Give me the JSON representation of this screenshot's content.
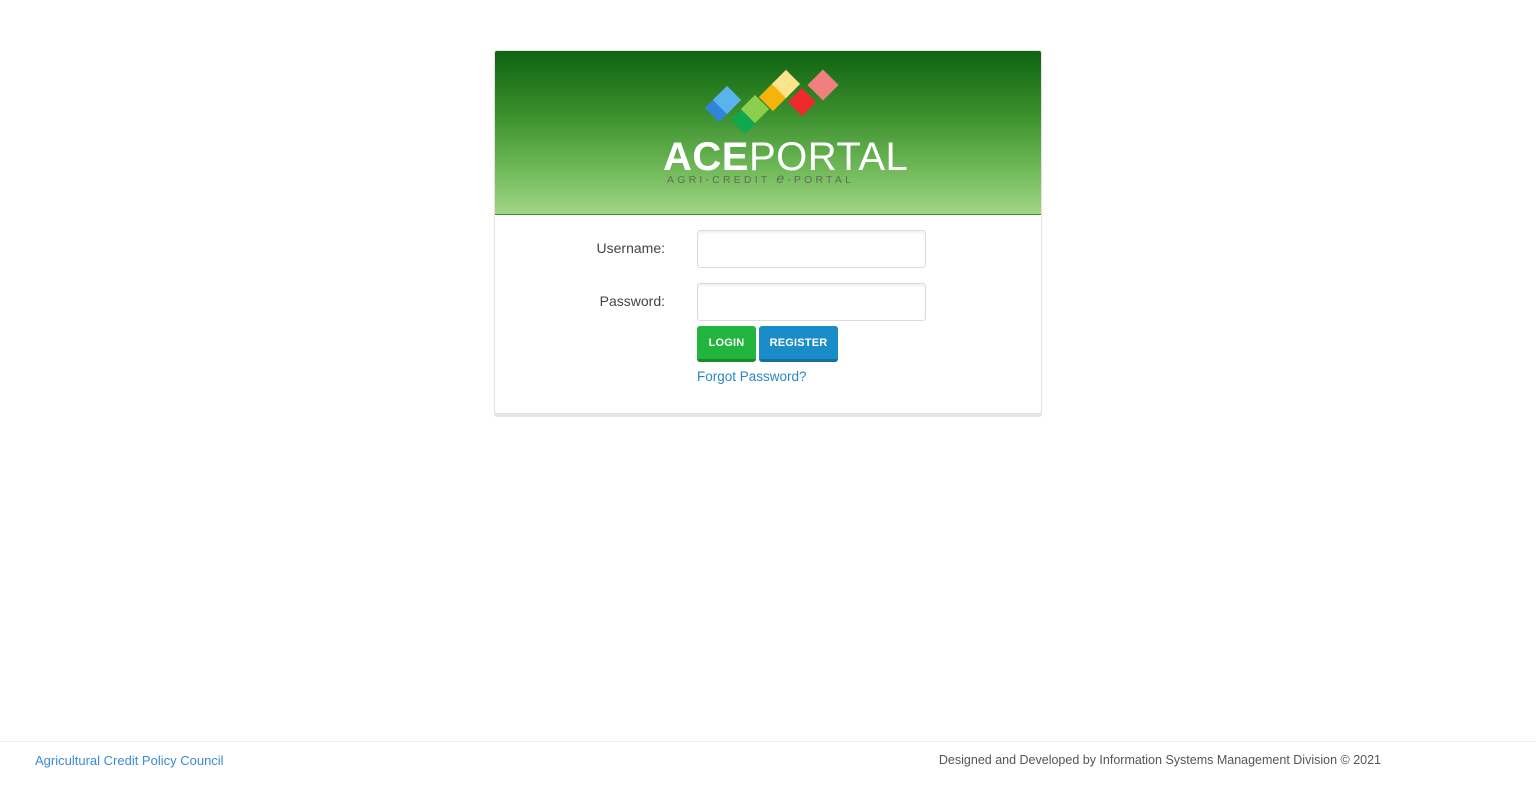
{
  "app": {
    "logo_text_bold": "ACE",
    "logo_text_regular": "PORTAL",
    "logo_tagline_pre": "AGRI-CREDIT ",
    "logo_tagline_e": "e",
    "logo_tagline_post": "-PORTAL"
  },
  "login_form": {
    "username_label": "Username:",
    "username_value": "",
    "password_label": "Password:",
    "password_value": "",
    "login_button": "LOGIN",
    "register_button": "REGISTER",
    "forgot_password_link": "Forgot Password?"
  },
  "footer": {
    "organization": "Agricultural Credit Policy Council",
    "credit": "Designed and Developed by Information Systems Management Division © 2021"
  },
  "colors": {
    "banner_top": "#0e6410",
    "banner_bottom": "#a2d686",
    "login_button": "#22b53d",
    "register_button": "#1a8dc8",
    "link": "#2a86c2",
    "logo_squares": [
      "#2f86d9",
      "#5ab4ec",
      "#0fa84e",
      "#8ccf4f",
      "#f6b40a",
      "#fde38c",
      "#ee2a2a",
      "#f08080"
    ]
  }
}
